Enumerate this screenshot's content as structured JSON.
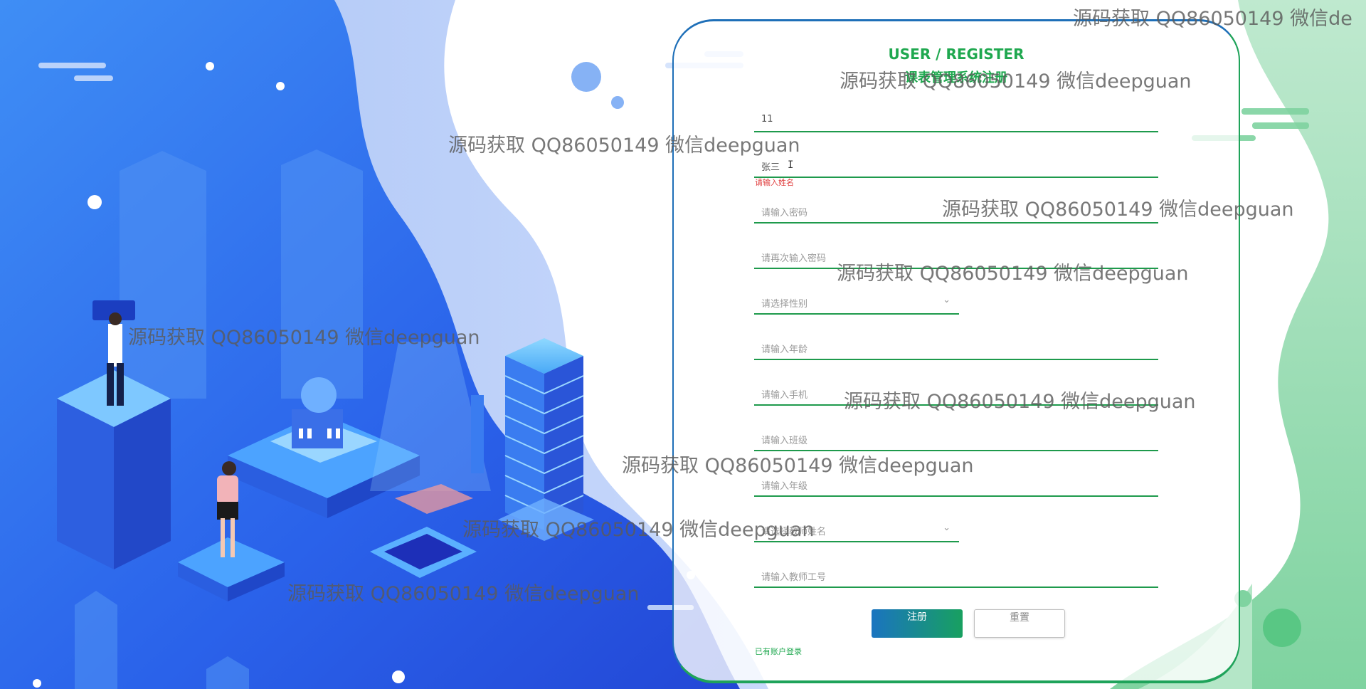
{
  "page": {
    "title": "USER / REGISTER",
    "subtitle": "课表管理系统注册"
  },
  "form": {
    "fields": [
      {
        "id": "account",
        "value": "11",
        "placeholder": ""
      },
      {
        "id": "name",
        "value": "张三",
        "placeholder": ""
      },
      {
        "id": "password",
        "value": "",
        "placeholder": "请输入密码"
      },
      {
        "id": "password2",
        "value": "",
        "placeholder": "请再次输入密码"
      },
      {
        "id": "gender",
        "value": "",
        "placeholder": "请选择性别"
      },
      {
        "id": "age",
        "value": "",
        "placeholder": "请输入年龄"
      },
      {
        "id": "phone",
        "value": "",
        "placeholder": "请输入手机"
      },
      {
        "id": "class",
        "value": "",
        "placeholder": "请输入班级"
      },
      {
        "id": "grade",
        "value": "",
        "placeholder": "请输入年级"
      },
      {
        "id": "teacher",
        "value": "",
        "placeholder": "请选择教师姓名"
      },
      {
        "id": "teacher_no",
        "value": "",
        "placeholder": "请输入教师工号"
      }
    ],
    "name_error": "请输入姓名",
    "submit_label": "注册",
    "reset_label": "重置",
    "login_link": "已有账户登录",
    "select_chevron": "⌄"
  },
  "watermark": "源码获取 QQ86050149 微信deepguan",
  "watermark_edge": "源码获取 QQ86050149 微信de",
  "colors": {
    "accent_green": "#1fa84f",
    "accent_blue": "#1e6fb8",
    "error_red": "#e04040"
  }
}
